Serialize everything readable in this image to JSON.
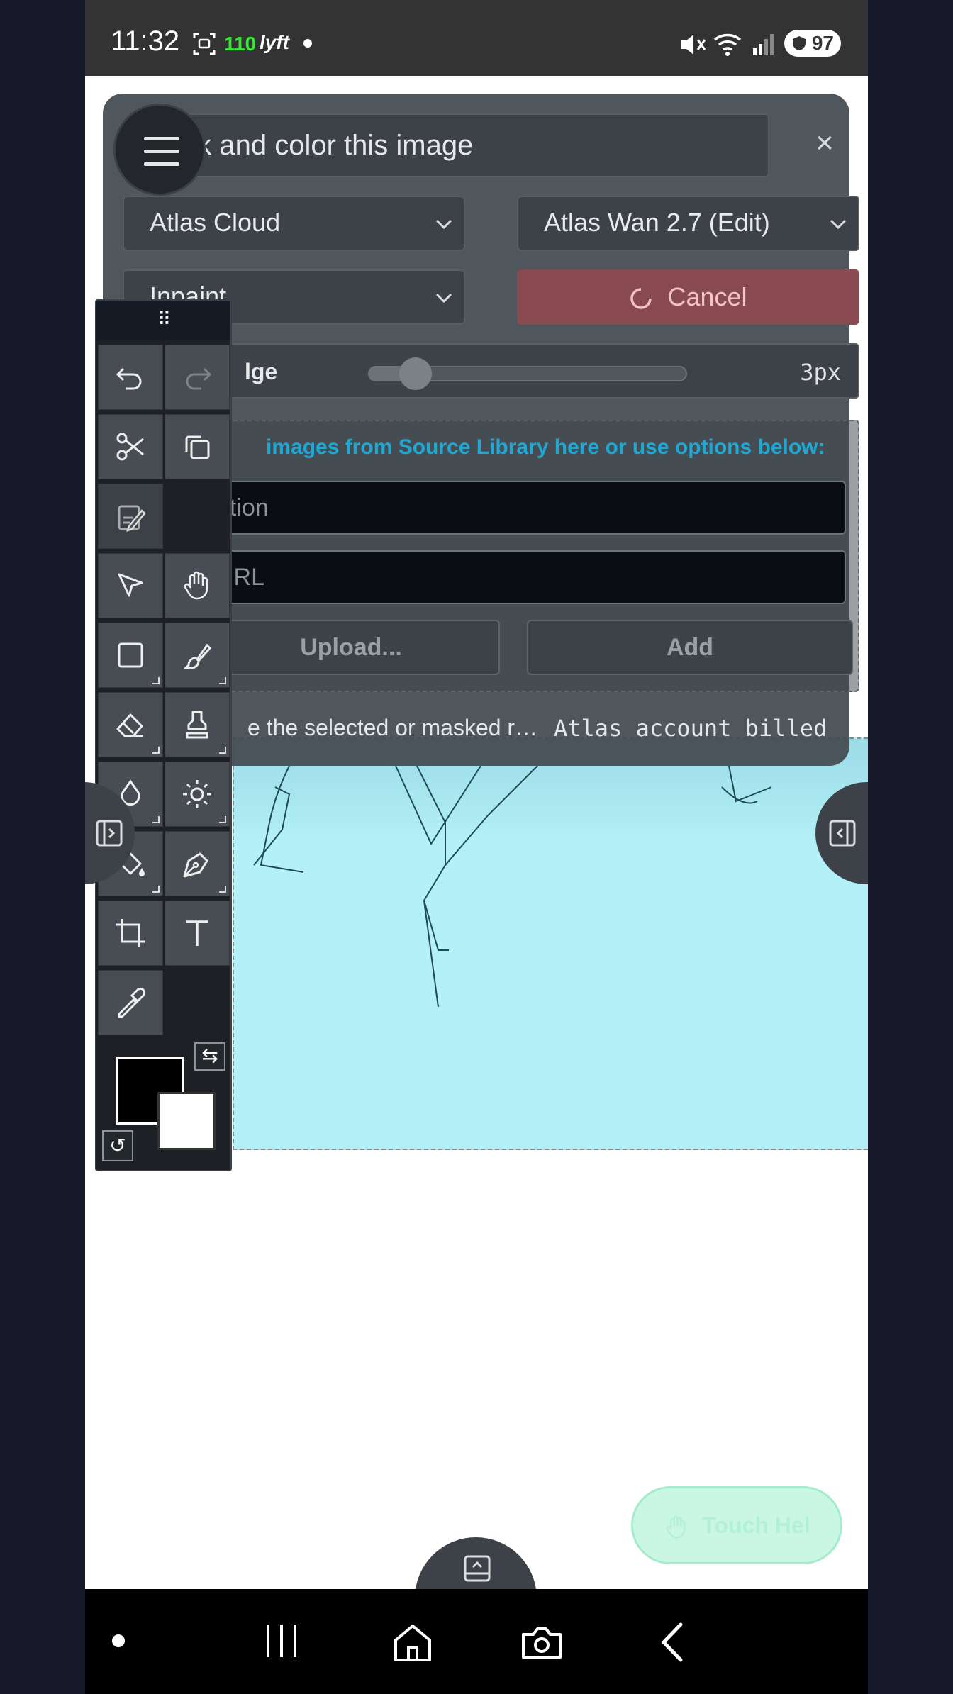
{
  "status_bar": {
    "time": "11:32",
    "indicator_number": "110",
    "app_badge": "lyft",
    "battery": "97"
  },
  "dialog": {
    "prompt_value": "nk and color this image",
    "provider_select": "Atlas Cloud",
    "model_select": "Atlas Wan 2.7 (Edit)",
    "mode_select": "Inpaint",
    "cancel_label": "Cancel",
    "edge_label": "lge",
    "edge_value": "3px",
    "edge_slider_fraction": 0.11,
    "source_hint": "images from Source Library here or use options below:",
    "caption_placeholder": "ption",
    "url_placeholder": "URL",
    "upload_label": "Upload...",
    "add_label": "Add",
    "footer_description": "e the selected or masked r…",
    "footer_billing": "Atlas account billed"
  },
  "toolbox": {
    "grip": "⠿",
    "primary_color": "#000000",
    "secondary_color": "#ffffff"
  },
  "bottom": {
    "touch_label": "Touch Hel"
  },
  "colors": {
    "dialog_bg": "#444c52",
    "accent_link": "#1fa8d4",
    "cancel_bg": "#8a4a52",
    "canvas_fill": "#b3f0f7",
    "touch_bg": "#c9f7e4"
  }
}
